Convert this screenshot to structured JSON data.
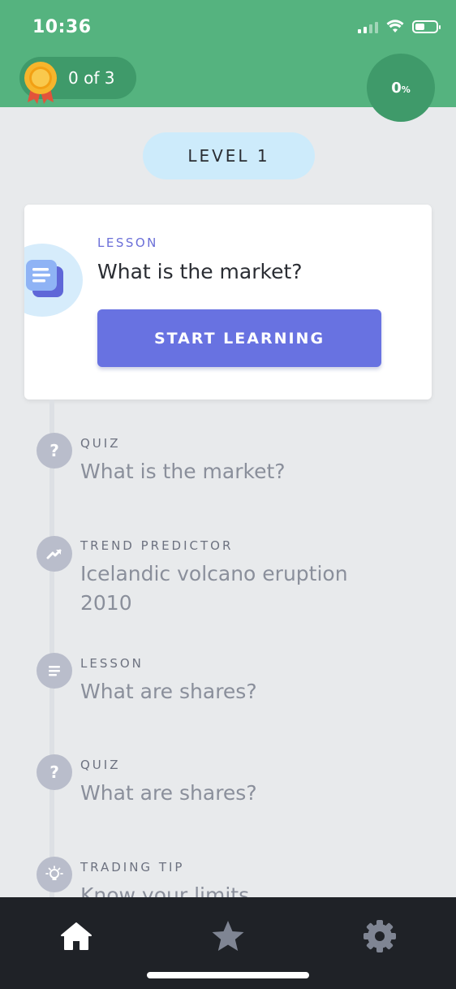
{
  "status_bar": {
    "time": "10:36"
  },
  "header": {
    "badge_label": "0 of 3",
    "progress_value": "0",
    "progress_unit": "%"
  },
  "level": {
    "label": "LEVEL 1"
  },
  "featured_card": {
    "type": "LESSON",
    "title": "What is the market?",
    "button_label": "START LEARNING"
  },
  "timeline": [
    {
      "type": "QUIZ",
      "title": "What is the market?",
      "icon": "question-icon"
    },
    {
      "type": "TREND PREDICTOR",
      "title": "Icelandic volcano eruption 2010",
      "icon": "trend-icon"
    },
    {
      "type": "LESSON",
      "title": "What are shares?",
      "icon": "lesson-icon"
    },
    {
      "type": "QUIZ",
      "title": "What are shares?",
      "icon": "question-icon"
    },
    {
      "type": "TRADING TIP",
      "title": "Know your limits",
      "icon": "lightbulb-icon"
    }
  ],
  "bottom_nav": [
    {
      "name": "home",
      "icon": "home-icon",
      "active": true
    },
    {
      "name": "favorites",
      "icon": "star-icon",
      "active": false
    },
    {
      "name": "settings",
      "icon": "gear-icon",
      "active": false
    }
  ],
  "colors": {
    "header_green": "#55b37f",
    "accent_purple": "#6872e1",
    "level_blue": "#cdebfb",
    "nav_dark": "#1f2227"
  }
}
